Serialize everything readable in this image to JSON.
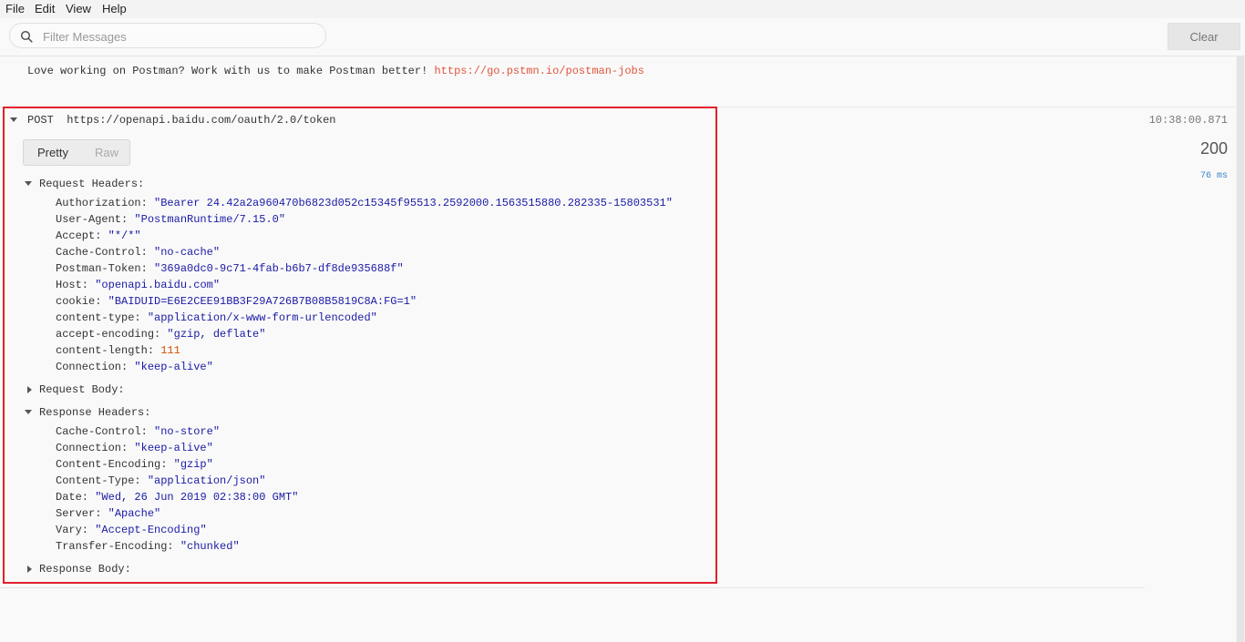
{
  "menu": {
    "file": "File",
    "edit": "Edit",
    "view": "View",
    "help": "Help"
  },
  "toolbar": {
    "search_placeholder": "Filter Messages",
    "search_value": "",
    "clear_label": "Clear"
  },
  "promo": {
    "text": "Love working on Postman? Work with us to make Postman better! ",
    "link": "https://go.pstmn.io/postman-jobs"
  },
  "request": {
    "method": "POST",
    "url": "https://openapi.baidu.com/oauth/2.0/token",
    "timestamp": "10:38:00.871",
    "status": "200",
    "duration": "76 ms",
    "tabs": {
      "pretty": "Pretty",
      "raw": "Raw",
      "active": "Pretty"
    },
    "request_headers_label": "Request Headers:",
    "request_headers": [
      {
        "key": "Authorization:",
        "value": "\"Bearer 24.42a2a960470b6823d052c15345f95513.2592000.1563515880.282335-15803531\""
      },
      {
        "key": "User-Agent:",
        "value": "\"PostmanRuntime/7.15.0\""
      },
      {
        "key": "Accept:",
        "value": "\"*/*\""
      },
      {
        "key": "Cache-Control:",
        "value": "\"no-cache\""
      },
      {
        "key": "Postman-Token:",
        "value": "\"369a0dc0-9c71-4fab-b6b7-df8de935688f\""
      },
      {
        "key": "Host:",
        "value": "\"openapi.baidu.com\""
      },
      {
        "key": "cookie:",
        "value": "\"BAIDUID=E6E2CEE91BB3F29A726B7B08B5819C8A:FG=1\""
      },
      {
        "key": "content-type:",
        "value": "\"application/x-www-form-urlencoded\""
      },
      {
        "key": "accept-encoding:",
        "value": "\"gzip, deflate\""
      },
      {
        "key": "content-length:",
        "value": "111"
      },
      {
        "key": "Connection:",
        "value": "\"keep-alive\""
      }
    ],
    "request_body_label": "Request Body:",
    "response_headers_label": "Response Headers:",
    "response_headers": [
      {
        "key": "Cache-Control:",
        "value": "\"no-store\""
      },
      {
        "key": "Connection:",
        "value": "\"keep-alive\""
      },
      {
        "key": "Content-Encoding:",
        "value": "\"gzip\""
      },
      {
        "key": "Content-Type:",
        "value": "\"application/json\""
      },
      {
        "key": "Date:",
        "value": "\"Wed, 26 Jun 2019 02:38:00 GMT\""
      },
      {
        "key": "Server:",
        "value": "\"Apache\""
      },
      {
        "key": "Vary:",
        "value": "\"Accept-Encoding\""
      },
      {
        "key": "Transfer-Encoding:",
        "value": "\"chunked\""
      }
    ],
    "response_body_label": "Response Body:"
  },
  "colors": {
    "highlight_border": "#e0202c",
    "string_value": "#1a1aa6",
    "number_value": "#d35400",
    "link": "#e2553d",
    "duration": "#3b84c7"
  }
}
